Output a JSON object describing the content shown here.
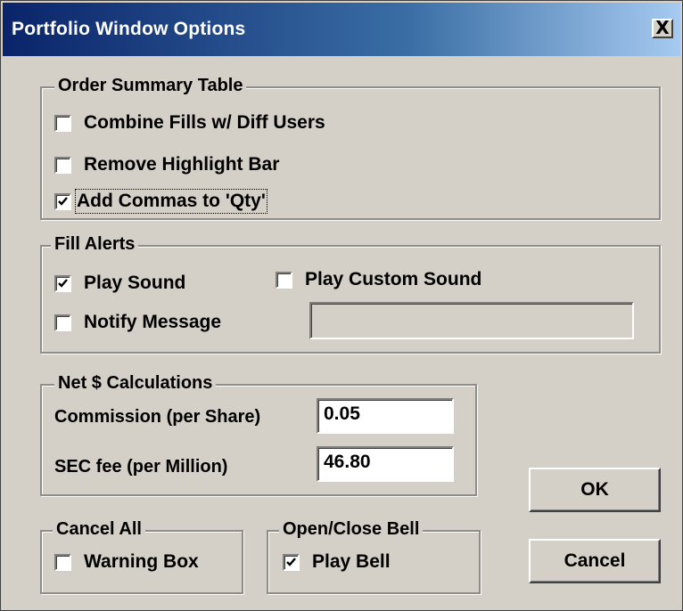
{
  "window": {
    "title": "Portfolio Window Options",
    "close_glyph": "X"
  },
  "order_summary": {
    "legend": "Order Summary Table",
    "items": [
      {
        "label": "Combine Fills w/ Diff Users",
        "checked": false
      },
      {
        "label": "Remove Highlight Bar",
        "checked": false
      },
      {
        "label": "Add Commas to 'Qty'",
        "checked": true
      }
    ]
  },
  "fill_alerts": {
    "legend": "Fill Alerts",
    "play_sound": {
      "label": "Play Sound",
      "checked": true
    },
    "play_custom_sound": {
      "label": "Play Custom Sound",
      "checked": false
    },
    "notify_message": {
      "label": "Notify Message",
      "checked": false
    },
    "custom_sound_path": ""
  },
  "net_calc": {
    "legend": "Net $ Calculations",
    "commission_label": "Commission (per Share)",
    "commission_value": "0.05",
    "sec_fee_label": "SEC fee (per Million)",
    "sec_fee_value": "46.80"
  },
  "cancel_all": {
    "legend": "Cancel All",
    "warning_box": {
      "label": "Warning Box",
      "checked": false
    }
  },
  "open_close_bell": {
    "legend": "Open/Close Bell",
    "play_bell": {
      "label": "Play Bell",
      "checked": true
    }
  },
  "buttons": {
    "ok": "OK",
    "cancel": "Cancel"
  },
  "icons": {
    "checkmark": "checkmark-icon",
    "close": "close-icon"
  },
  "colors": {
    "title_start": "#0a246a",
    "title_end": "#a6caf0",
    "face": "#d4d0c8"
  }
}
